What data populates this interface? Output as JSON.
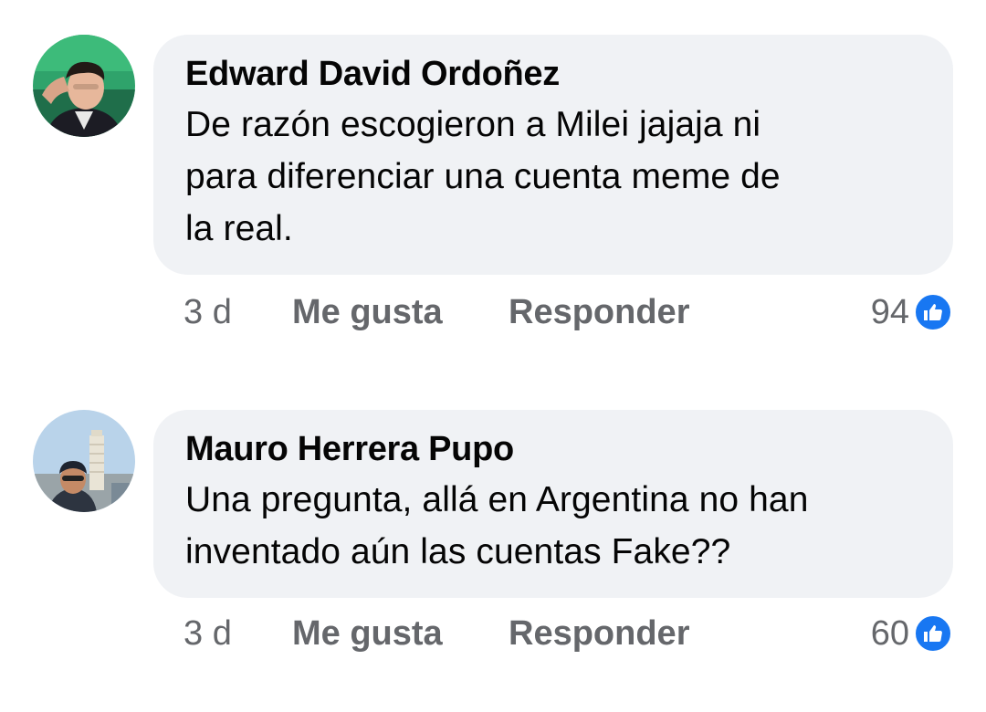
{
  "comments": [
    {
      "author": "Edward David Ordoñez",
      "lines": [
        "De razón escogieron a Milei jajaja ni",
        "para diferenciar una cuenta meme de",
        "la real."
      ],
      "time": "3 d",
      "like_label": "Me gusta",
      "reply_label": "Responder",
      "reaction_count": "94",
      "reaction_icon": "thumbs-up-icon",
      "avatar": "person-avatar-green-background"
    },
    {
      "author": "Mauro Herrera Pupo",
      "lines": [
        "Una pregunta, allá en Argentina no han",
        "inventado aún las cuentas Fake??"
      ],
      "time": "3 d",
      "like_label": "Me gusta",
      "reply_label": "Responder",
      "reaction_count": "60",
      "reaction_icon": "thumbs-up-icon",
      "avatar": "person-avatar-leaning-tower"
    }
  ],
  "colors": {
    "bubble": "#f0f2f5",
    "text": "#050505",
    "secondary": "#65676b",
    "reaction_blue": "#1877f2"
  }
}
